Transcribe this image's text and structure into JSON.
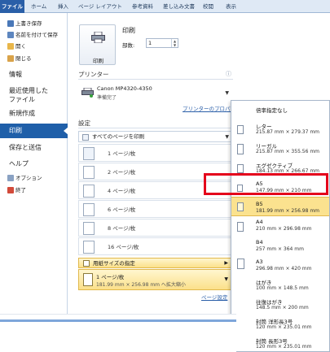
{
  "ribbon": {
    "tabs": [
      "ファイル",
      "ホーム",
      "挿入",
      "ページ レイアウト",
      "参考資料",
      "差し込み文書",
      "校閲",
      "表示"
    ]
  },
  "leftnav": {
    "small_top": [
      {
        "label": "上書き保存",
        "icon": "save-icon"
      },
      {
        "label": "名前を付けて保存",
        "icon": "save-as-icon"
      },
      {
        "label": "開く",
        "icon": "open-folder-icon"
      },
      {
        "label": "閉じる",
        "icon": "close-doc-icon"
      }
    ],
    "info": "情報",
    "recent_line1": "最近使用した",
    "recent_line2": "ファイル",
    "new": "新規作成",
    "print": "印刷",
    "save_send": "保存と送信",
    "help": "ヘルプ",
    "options": "オプション",
    "exit": "終了"
  },
  "print": {
    "button_label": "印刷",
    "title": "印刷",
    "copies_label": "部数:",
    "copies_value": "1"
  },
  "printer": {
    "section": "プリンター",
    "info_glyph": "ⓘ",
    "name": "Canon MP4320-4350",
    "status": "準備完了",
    "properties_link": "プリンターのプロパティ"
  },
  "settings": {
    "section": "設定",
    "pages_combo": "すべてのページを印刷",
    "options": [
      "1 ページ/枚",
      "2 ページ/枚",
      "4 ページ/枚",
      "6 ページ/枚",
      "8 ページ/枚",
      "16 ページ/枚"
    ],
    "scale_paper": "用紙サイズの指定",
    "current_line1": "1 ページ/枚",
    "current_line2": "181.99 mm × 256.98 mm へ拡大縮小",
    "page_setup_link": "ページ設定"
  },
  "paper_list": {
    "items": [
      {
        "name": "倍率指定なし",
        "size": ""
      },
      {
        "name": "レター",
        "size": "215.87 mm × 279.37 mm"
      },
      {
        "name": "リーガル",
        "size": "215.87 mm × 355.56 mm"
      },
      {
        "name": "エグゼクティブ",
        "size": "184.13 mm × 266.67 mm"
      },
      {
        "name": "A5",
        "size": "147.99 mm × 210 mm"
      },
      {
        "name": "B5",
        "size": "181.99 mm × 256.98 mm"
      },
      {
        "name": "A4",
        "size": "210 mm × 296.98 mm"
      },
      {
        "name": "B4",
        "size": "257 mm × 364 mm"
      },
      {
        "name": "A3",
        "size": "296.98 mm × 420 mm"
      },
      {
        "name": "はがき",
        "size": "100 mm × 148.5 mm"
      },
      {
        "name": "往復はがき",
        "size": "148.5 mm × 200 mm"
      },
      {
        "name": "封筒 洋形長3号",
        "size": "120 mm × 235.01 mm"
      },
      {
        "name": "封筒 長形3号",
        "size": "120 mm × 235.01 mm"
      }
    ],
    "selected_index": 5
  },
  "colors": {
    "accent": "#1f5fa9",
    "highlight_border": "#e4001b",
    "selected_yellow": "#fbe28f"
  }
}
